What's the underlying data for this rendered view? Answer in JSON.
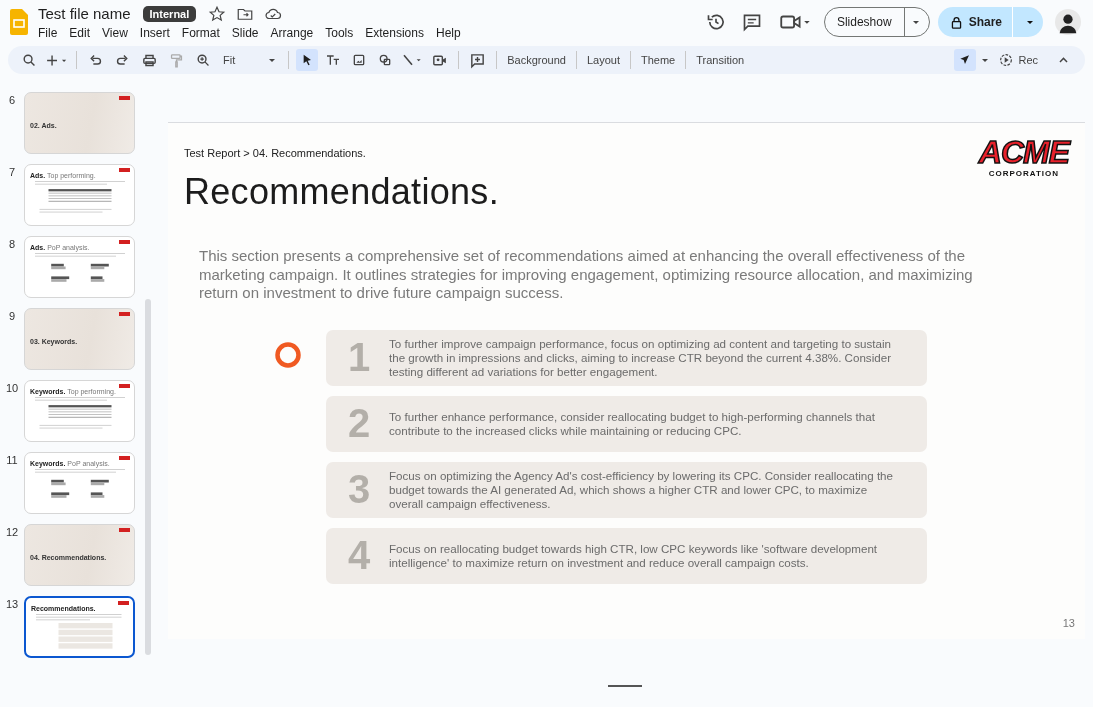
{
  "document": {
    "title": "Test file name",
    "badge": "Internal"
  },
  "menu": [
    "File",
    "Edit",
    "View",
    "Insert",
    "Format",
    "Slide",
    "Arrange",
    "Tools",
    "Extensions",
    "Help"
  ],
  "header_buttons": {
    "slideshow": "Slideshow",
    "share": "Share"
  },
  "toolbar": {
    "zoom": "Fit",
    "tools": [
      {
        "kind": "pointer",
        "selected": true
      },
      {
        "kind": "text",
        "selected": false
      },
      {
        "kind": "image",
        "selected": false
      },
      {
        "kind": "shape",
        "selected": false
      },
      {
        "kind": "line",
        "selected": false
      }
    ],
    "actions": [
      "Background",
      "Layout",
      "Theme",
      "Transition"
    ],
    "rec": "Rec",
    "laser_selected": true
  },
  "slides": [
    {
      "number": "6",
      "kind": "section",
      "title": "02. Ads.",
      "selected": false
    },
    {
      "number": "7",
      "kind": "table",
      "title": "Ads.",
      "subtitle": "Top performing.",
      "selected": false
    },
    {
      "number": "8",
      "kind": "bars",
      "title": "Ads.",
      "subtitle": "PoP analysis.",
      "selected": false
    },
    {
      "number": "9",
      "kind": "section",
      "title": "03. Keywords.",
      "selected": false
    },
    {
      "number": "10",
      "kind": "table",
      "title": "Keywords.",
      "subtitle": "Top performing.",
      "selected": false
    },
    {
      "number": "11",
      "kind": "bars",
      "title": "Keywords.",
      "subtitle": "PoP analysis.",
      "selected": false
    },
    {
      "number": "12",
      "kind": "section",
      "title": "04. Recommendations.",
      "selected": false
    },
    {
      "number": "13",
      "kind": "list",
      "title": "Recommendations.",
      "selected": true
    }
  ],
  "slide": {
    "breadcrumb": "Test Report > 04. Recommendations.",
    "title": "Recommendations.",
    "logo": {
      "name": "ACME",
      "tagline": "CORPORATION"
    },
    "intro": "This section presents a comprehensive set of recommendations aimed at enhancing the overall effectiveness of the marketing campaign. It outlines strategies for improving engagement, optimizing resource allocation, and maximizing return on investment to drive future campaign success.",
    "items": [
      {
        "number": "1",
        "text": "To further improve campaign performance, focus on optimizing ad content and targeting to sustain the growth in impressions and clicks, aiming to increase CTR beyond the current 4.38%. Consider testing different ad variations for better engagement."
      },
      {
        "number": "2",
        "text": "To further enhance performance, consider reallocating budget to high-performing channels that contribute to the increased clicks while maintaining or reducing CPC."
      },
      {
        "number": "3",
        "text": "Focus on optimizing the Agency Ad's cost-efficiency by lowering its CPC. Consider reallocating the budget towards the AI generated Ad, which shows a higher CTR and lower CPC, to maximize overall campaign effectiveness."
      },
      {
        "number": "4",
        "text": "Focus on reallocating budget towards high CTR, low CPC keywords like 'software development intelligence' to maximize return on investment and reduce overall campaign costs."
      }
    ],
    "page_number": "13"
  }
}
